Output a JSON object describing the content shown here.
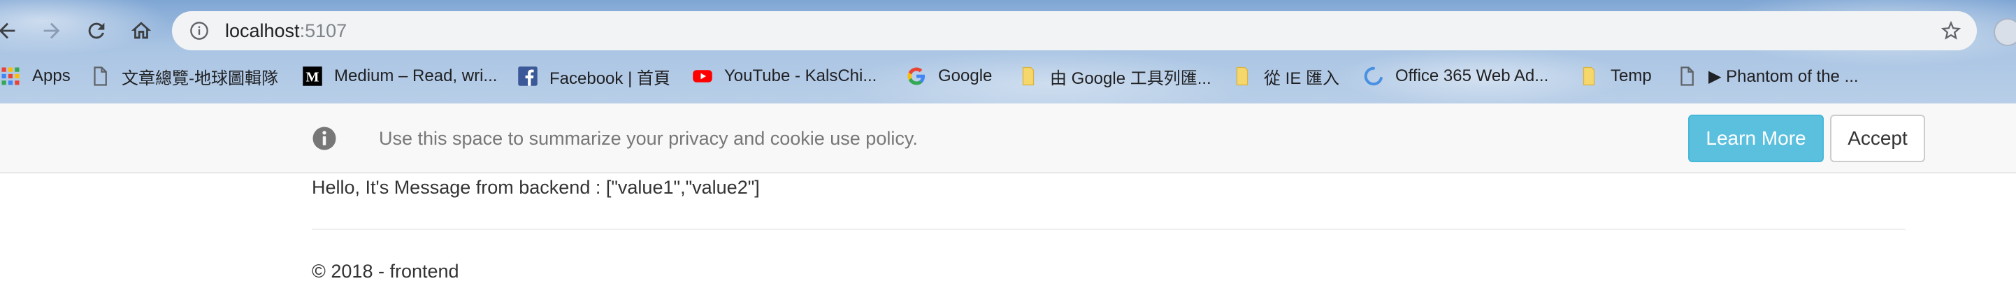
{
  "browser": {
    "address": {
      "host": "localhost",
      "port": ":5107"
    },
    "bookmarks": [
      {
        "label": "Apps",
        "icon": "apps-grid-icon"
      },
      {
        "label": "文章總覽-地球圖輯隊",
        "icon": "page-icon"
      },
      {
        "label": "Medium – Read, wri...",
        "icon": "medium-icon"
      },
      {
        "label": "Facebook | 首頁",
        "icon": "facebook-icon"
      },
      {
        "label": "YouTube - KalsChi...",
        "icon": "youtube-icon"
      },
      {
        "label": "Google",
        "icon": "google-icon"
      },
      {
        "label": "由 Google 工具列匯...",
        "icon": "folder-icon"
      },
      {
        "label": "從 IE 匯入",
        "icon": "folder-icon"
      },
      {
        "label": "Office 365 Web Ad...",
        "icon": "office-icon"
      },
      {
        "label": "Temp",
        "icon": "folder-icon"
      },
      {
        "label": "▶ Phantom of the ...",
        "icon": "page-icon"
      }
    ]
  },
  "cookie_banner": {
    "text": "Use this space to summarize your privacy and cookie use policy.",
    "learn_more": "Learn More",
    "accept": "Accept"
  },
  "main": {
    "message": "Hello, It's Message from backend : [\"value1\",\"value2\"]"
  },
  "footer": {
    "text": "© 2018 - frontend"
  },
  "colors": {
    "learn_more_bg": "#5bc0de",
    "banner_bg": "#f8f8f8"
  }
}
